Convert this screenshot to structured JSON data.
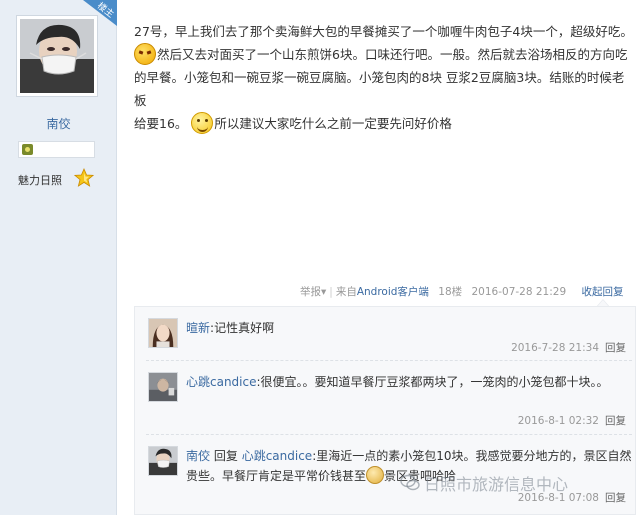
{
  "user": {
    "badge": "楼主",
    "name": "南佼",
    "charm_label": "魅力日照"
  },
  "post": {
    "line1": "27号，早上我们去了那个卖海鲜大包的早餐摊买了一个咖喱牛肉包子4块一个，超级好吃。",
    "line2": "然后又去对面买了一个山东煎饼6块。口味还行吧。一般。然后就去浴场相反的方向吃",
    "line3": "的早餐。小笼包和一碗豆浆一碗豆腐脑。小笼包肉的8块 豆浆2豆腐脑3块。结账的时候老板",
    "line4a": "给要16。",
    "line4b": "所以建议大家吃什么之前一定要先问好价格"
  },
  "meta": {
    "report": "举报",
    "report_arrow": "▾",
    "sep": "|",
    "from": "来自",
    "client": "Android客户端",
    "floor": "18楼",
    "time": "2016-07-28 21:29",
    "reply_link": "收起回复"
  },
  "replies": [
    {
      "user": "暄新",
      "colon": ":",
      "text": "记性真好啊",
      "time": "2016-7-28 21:34",
      "action": "回复"
    },
    {
      "user": "心跳candice",
      "colon": ":",
      "text": "很便宜。。要知道早餐厅豆浆都两块了，一笼肉的小笼包都十块。。",
      "time": "2016-8-1 02:32",
      "action": "回复"
    },
    {
      "user": "南佼",
      "reply_word": "回复",
      "target": "心跳candice",
      "colon": ":",
      "text": "里海近一点的素小笼包10块。我感觉要分地方的，景区自然贵些。早餐厅肯定是平常价钱甚至",
      "text_tail": "景区贵吧哈哈",
      "time": "2016-8-1 07:08",
      "action": "回复"
    }
  ],
  "watermark": "日照市旅游信息中心"
}
